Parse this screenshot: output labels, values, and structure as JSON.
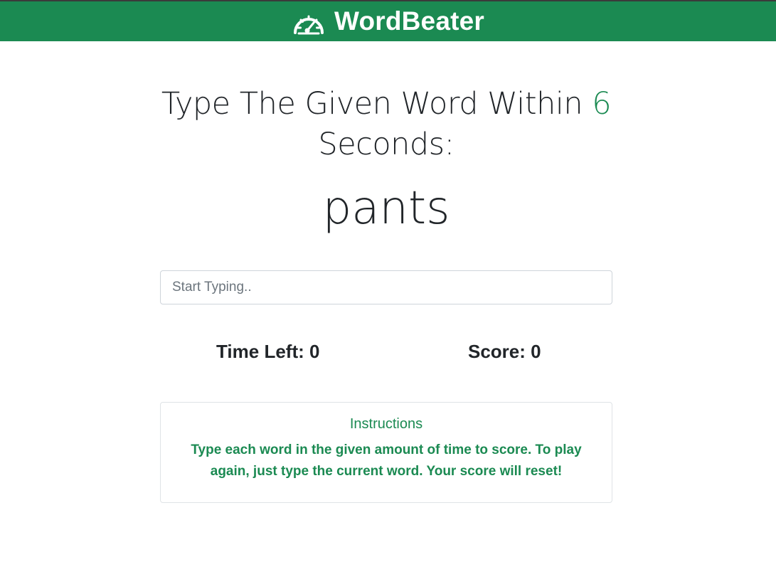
{
  "header": {
    "brand_name": "WordBeater",
    "icon": "tachometer-icon"
  },
  "main": {
    "lead_text": "Type The Given Word Within ",
    "seconds": "6",
    "lead_suffix": " Seconds:",
    "current_word": "pants",
    "input": {
      "placeholder": "Start Typing..",
      "value": ""
    },
    "time_left_label": "Time Left: ",
    "time_left_value": "0",
    "score_label": "Score: ",
    "score_value": "0"
  },
  "instructions": {
    "title": "Instructions",
    "text": "Type each word in the given amount of time to score. To play again, just type the current word. Your score will reset!"
  },
  "colors": {
    "brand": "#1b8a52",
    "text": "#212529"
  }
}
